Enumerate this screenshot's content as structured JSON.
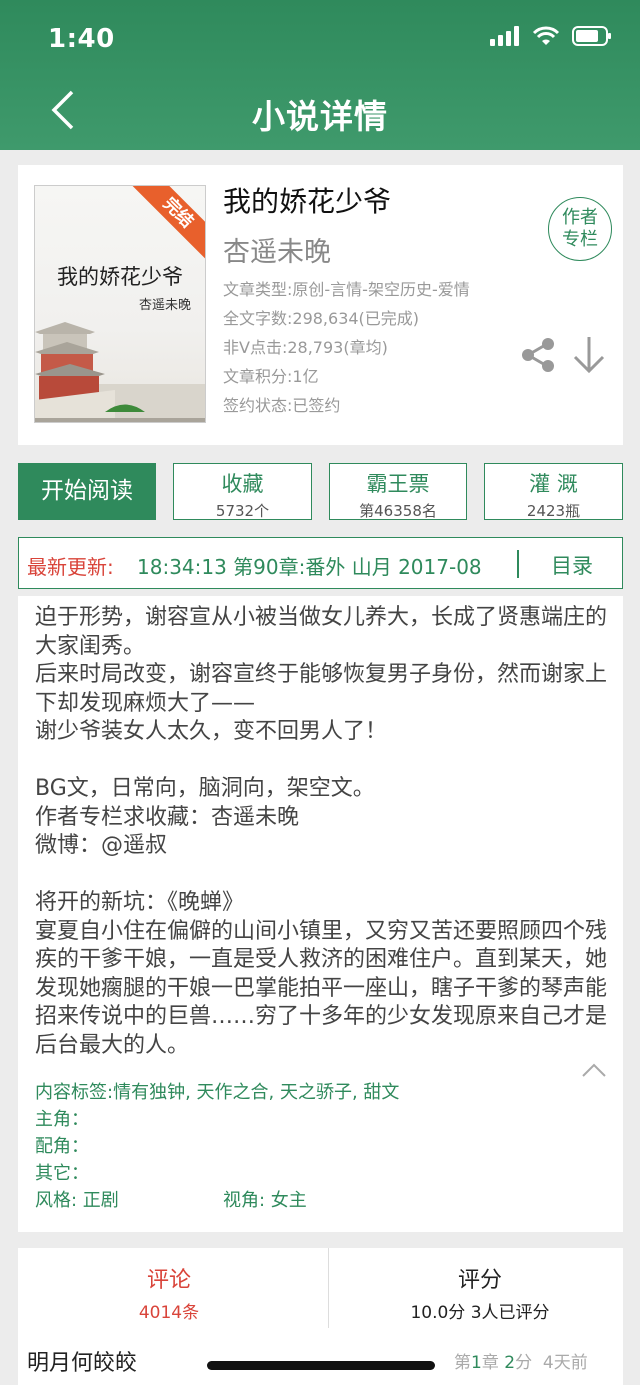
{
  "status_bar": {
    "time": "1:40"
  },
  "nav": {
    "title": "小说详情"
  },
  "book": {
    "title": "我的娇花少爷",
    "author": "杏遥未晚",
    "type": "文章类型:原创-言情-架空历史-爱情",
    "word_count": "全文字数:298,634(已完成)",
    "clicks": "非V点击:28,793(章均)",
    "score": "文章积分:1亿",
    "contract": "签约状态:已签约",
    "author_badge": [
      "作者",
      "专栏"
    ],
    "cover": {
      "title": "我的娇花少爷",
      "author": "杏遥未晚",
      "ribbon": "完结"
    }
  },
  "actions": {
    "start": "开始阅读",
    "collect": {
      "label": "收藏",
      "value": "5732个"
    },
    "ticket": {
      "label": "霸王票",
      "value": "第46358名"
    },
    "irrigate": {
      "label": "灌 溉",
      "value": "2423瓶"
    }
  },
  "update": {
    "label": "最新更新:",
    "text": "18:34:13   第90章:番外 山月 2017-08",
    "toc": "目录"
  },
  "description": [
    "迫于形势，谢容宣从小被当做女儿养大，长成了贤惠端庄的大家闺秀。",
    "后来时局改变，谢容宣终于能够恢复男子身份，然而谢家上下却发现麻烦大了——",
    "谢少爷装女人太久，变不回男人了！",
    "",
    "BG文，日常向，脑洞向，架空文。",
    "作者专栏求收藏：杏遥未晚",
    "微博：@遥叔",
    "",
    "将开的新坑：《晚蝉》",
    "宴夏自小住在偏僻的山间小镇里，又穷又苦还要照顾四个残疾的干爹干娘，一直是受人救济的困难住户。直到某天，她发现她瘸腿的干娘一巴掌能拍平一座山，瞎子干爹的琴声能招来传说中的巨兽……穷了十多年的少女发现原来自己才是后台最大的人。"
  ],
  "tags": {
    "content": "内容标签:情有独钟, 天作之合, 天之骄子, 甜文",
    "lead": "主角：",
    "support": "配角：",
    "other": "其它：",
    "style": "风格: 正剧",
    "view": "视角: 女主"
  },
  "stats": {
    "comments": {
      "label": "评论",
      "value": "4014条"
    },
    "rating": {
      "label": "评分",
      "value": "10.0分 3人已评分"
    }
  },
  "comment_preview": {
    "user": "明月何皎皎",
    "chapter_prefix": "第",
    "chapter_num": "1",
    "chapter_mid": "章 ",
    "score_num": "2",
    "score_suffix": "分",
    "time": "4天前"
  },
  "colors": {
    "brand": "#2f8a5c",
    "accent_red": "#d9443a",
    "ribbon": "#e8602c"
  }
}
